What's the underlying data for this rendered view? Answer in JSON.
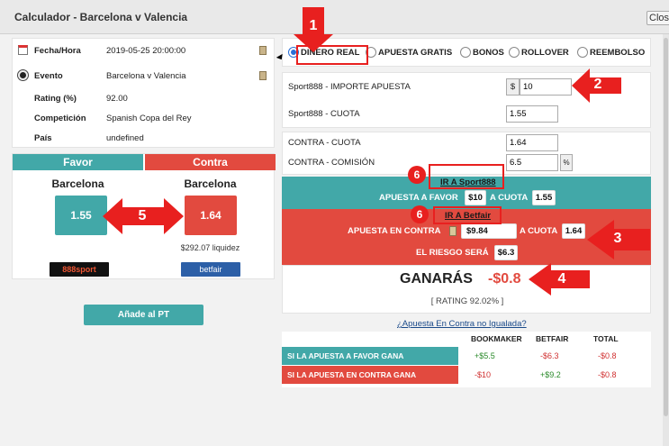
{
  "window": {
    "title": "Calculador - Barcelona v Valencia",
    "close_label": "Close"
  },
  "info": {
    "rows": [
      {
        "label": "Fecha/Hora",
        "value": "2019-05-25 20:00:00"
      },
      {
        "label": "Evento",
        "value": "Barcelona v Valencia"
      },
      {
        "label": "Rating (%)",
        "value": "92.00"
      },
      {
        "label": "Competición",
        "value": "Spanish Copa del Rey"
      },
      {
        "label": "País",
        "value": "undefined"
      }
    ]
  },
  "favor": {
    "header": "Favor",
    "team": "Barcelona",
    "odd": "1.55",
    "logo": "888sport"
  },
  "contra": {
    "header": "Contra",
    "team": "Barcelona",
    "odd": "1.64",
    "liquidity": "$292.07 liquidez",
    "logo": "betfair"
  },
  "add_pt_label": "Añade al PT",
  "modes": [
    {
      "label": "DINERO REAL",
      "selected": true
    },
    {
      "label": "APUESTA GRATIS",
      "selected": false
    },
    {
      "label": "BONOS",
      "selected": false
    },
    {
      "label": "ROLLOVER",
      "selected": false
    },
    {
      "label": "REEMBOLSO",
      "selected": false
    }
  ],
  "inputs": {
    "stake_label": "Sport888 - IMPORTE APUESTA",
    "stake_prefix": "$",
    "stake_value": "10",
    "odd_label": "Sport888 - CUOTA",
    "odd_value": "1.55",
    "lay_odd_label": "CONTRA - CUOTA",
    "lay_odd_value": "1.64",
    "commission_label": "CONTRA - COMISIÓN",
    "commission_value": "6.5",
    "commission_suffix": "%"
  },
  "back": {
    "link": "IR A Sport888",
    "bet_label": "APUESTA A FAVOR",
    "bet_amount": "$10",
    "odd_label": "A CUOTA",
    "odd": "1.55"
  },
  "lay": {
    "link": "IR A Betfair",
    "bet_label": "APUESTA EN CONTRA",
    "bet_amount": "$9.84",
    "odd_label": "A CUOTA",
    "odd": "1.64",
    "risk_label": "EL RIESGO SERÁ",
    "risk": "$6.3"
  },
  "result": {
    "label": "GANARÁS",
    "value": "-$0.8",
    "rating": "[ RATING 92.02% ]"
  },
  "unmatched_link": "¿Apuesta En Contra no Igualada?",
  "summary": {
    "headers": [
      "BOOKMAKER",
      "BETFAIR",
      "TOTAL"
    ],
    "rows": [
      {
        "label": "SI LA APUESTA A FAVOR GANA",
        "color": "#42a8a8",
        "values": [
          "+$5.5",
          "-$6.3",
          "-$0.8"
        ]
      },
      {
        "label": "SI LA APUESTA EN CONTRA GANA",
        "color": "#e24a3f",
        "values": [
          "-$10",
          "+$9.2",
          "-$0.8"
        ]
      }
    ]
  },
  "annotations": [
    "1",
    "2",
    "3",
    "4",
    "5",
    "6",
    "6"
  ],
  "colors": {
    "teal": "#42a8a8",
    "red": "#e24a3f",
    "annotation": "#e8201f"
  }
}
